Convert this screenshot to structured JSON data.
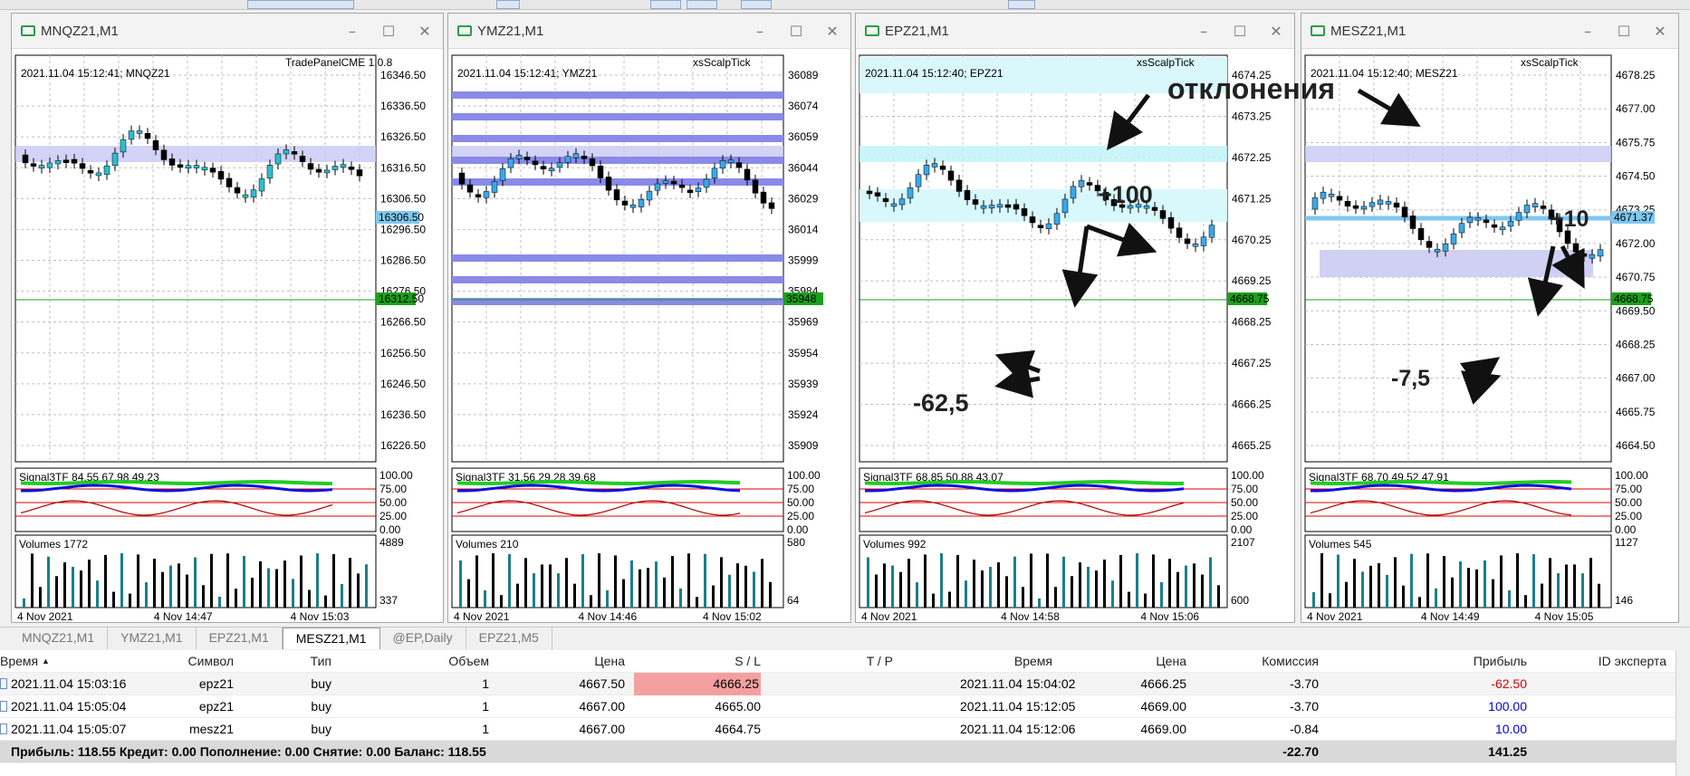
{
  "windows": [
    {
      "title": "MNQZ21,M1",
      "date": "2021.11.04 15:12:41; MNQZ21",
      "indicator": "TradePanelCME 1.0.8",
      "prices": [
        "16346.50",
        "16336.50",
        "16326.50",
        "16316.50",
        "16306.50",
        "16296.50",
        "16286.50",
        "16276.50",
        "16266.50",
        "16256.50",
        "16246.50",
        "16236.50",
        "16226.50"
      ],
      "price_tag": "16312.50",
      "price_tag2": "16306.50",
      "signal": "Signal3TF 84.55 67.98 49.23",
      "signal_axis": [
        "100.00",
        "75.00",
        "50.00",
        "25.00",
        "0.00"
      ],
      "volumes": "Volumes 1772",
      "vol_axis": [
        "4889",
        "337"
      ],
      "times": [
        "4 Nov 2021",
        "4 Nov 14:47",
        "4 Nov 15:03"
      ]
    },
    {
      "title": "YMZ21,M1",
      "date": "2021.11.04 15:12:41; YMZ21",
      "indicator": "xsScalpTick",
      "prices": [
        "36089",
        "36074",
        "36059",
        "36044",
        "36029",
        "36014",
        "35999",
        "35984",
        "35969",
        "35954",
        "35939",
        "35924",
        "35909"
      ],
      "price_tag": "35948",
      "price_tag2": "",
      "signal": "Signal3TF 31.56 29.28 39.68",
      "signal_axis": [
        "100.00",
        "75.00",
        "50.00",
        "25.00",
        "0.00"
      ],
      "volumes": "Volumes 210",
      "vol_axis": [
        "580",
        "64"
      ],
      "times": [
        "4 Nov 2021",
        "4 Nov 14:46",
        "4 Nov 15:02"
      ]
    },
    {
      "title": "EPZ21,M1",
      "date": "2021.11.04 15:12:40; EPZ21",
      "indicator": "xsScalpTick",
      "prices": [
        "4674.25",
        "4673.25",
        "4672.25",
        "4671.25",
        "4670.25",
        "4669.25",
        "4668.25",
        "4667.25",
        "4666.25",
        "4665.25"
      ],
      "price_tag": "4668.75",
      "price_tag2": "",
      "signal": "Signal3TF 68.85 50.88 43.07",
      "signal_axis": [
        "100.00",
        "75.00",
        "50.00",
        "25.00",
        "0.00"
      ],
      "volumes": "Volumes 992",
      "vol_axis": [
        "2107",
        "600"
      ],
      "times": [
        "4 Nov 2021",
        "4 Nov 14:58",
        "4 Nov 15:06"
      ]
    },
    {
      "title": "MESZ21,M1",
      "date": "2021.11.04 15:12:40; MESZ21",
      "indicator": "xsScalpTick",
      "prices": [
        "4678.25",
        "4677.00",
        "4675.75",
        "4674.50",
        "4673.25",
        "4672.00",
        "4670.75",
        "4669.50",
        "4668.25",
        "4667.00",
        "4665.75",
        "4664.50"
      ],
      "price_tag": "4668.75",
      "price_tag2": "4671.37",
      "signal": "Signal3TF 68.70 49.52 47.91",
      "signal_axis": [
        "100.00",
        "75.00",
        "50.00",
        "25.00",
        "0.00"
      ],
      "volumes": "Volumes 545",
      "vol_axis": [
        "1127",
        "146"
      ],
      "times": [
        "4 Nov 2021",
        "4 Nov 14:49",
        "4 Nov 15:05"
      ]
    }
  ],
  "annotations": {
    "deviations": "отклонения",
    "plus100": "+100",
    "minus625": "-62,5",
    "plus10": "+10",
    "minus75": "-7,5"
  },
  "tabs": [
    "MNQZ21,M1",
    "YMZ21,M1",
    "EPZ21,M1",
    "MESZ21,M1",
    "@EP,Daily",
    "EPZ21,M5"
  ],
  "table": {
    "headers": [
      "Время",
      "Символ",
      "Тип",
      "Объем",
      "Цена",
      "S / L",
      "T / P",
      "Время",
      "Цена",
      "Комиссия",
      "Прибыль",
      "ID эксперта"
    ],
    "rows": [
      [
        "2021.11.04 15:03:16",
        "epz21",
        "buy",
        "1",
        "4667.50",
        "4666.25",
        "",
        "2021.11.04 15:04:02",
        "4666.25",
        "-3.70",
        "-62.50",
        ""
      ],
      [
        "2021.11.04 15:05:04",
        "epz21",
        "buy",
        "1",
        "4667.00",
        "4665.00",
        "",
        "2021.11.04 15:12:05",
        "4669.00",
        "-3.70",
        "100.00",
        ""
      ],
      [
        "2021.11.04 15:05:07",
        "mesz21",
        "buy",
        "1",
        "4667.00",
        "4664.75",
        "",
        "2021.11.04 15:12:06",
        "4669.00",
        "-0.84",
        "10.00",
        ""
      ]
    ],
    "summary": "Прибыль: 118.55  Кредит: 0.00  Пополнение: 0.00  Снятие: 0.00  Баланс: 118.55",
    "sum_commission": "-22.70",
    "sum_profit": "141.25"
  }
}
